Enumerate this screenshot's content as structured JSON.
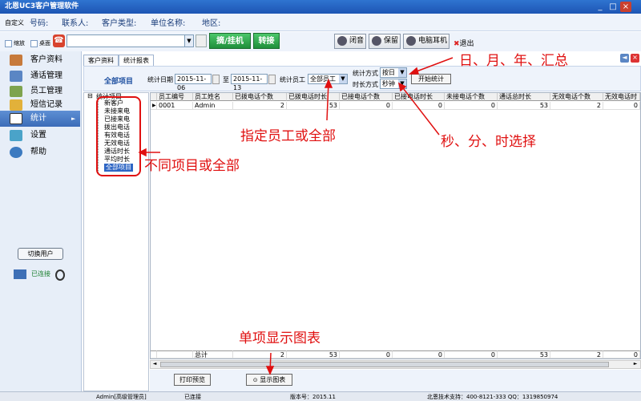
{
  "app_title": "北恩UC3客户管理软件",
  "window_controls": [
    "_",
    "□",
    "×"
  ],
  "infobar": {
    "customize": "自定义",
    "number_label": "号码:",
    "contact_label": "联系人:",
    "customer_type_label": "客户类型:",
    "company_label": "单位名称:",
    "region_label": "地区:"
  },
  "toolbar": {
    "minimize_label": "缩放",
    "desktop_label": "桌面",
    "answer_hangup": "摘/挂机",
    "transfer": "转接",
    "mute": "闭音",
    "hold": "保留",
    "headset": "电脑耳机",
    "exit": "退出"
  },
  "sidebar": {
    "items": [
      {
        "label": "客户资料",
        "icon": "contacts-icon"
      },
      {
        "label": "通话管理",
        "icon": "calls-icon"
      },
      {
        "label": "员工管理",
        "icon": "staff-icon"
      },
      {
        "label": "短信记录",
        "icon": "sms-icon"
      },
      {
        "label": "统计",
        "icon": "stats-icon"
      },
      {
        "label": "设置",
        "icon": "settings-icon"
      },
      {
        "label": "帮助",
        "icon": "help-icon"
      }
    ],
    "switch_user": "切换用户",
    "connected": "已连接"
  },
  "tabs": [
    "客户资料",
    "统计报表"
  ],
  "filter": {
    "scope_title": "全部项目",
    "date_label": "统计日期",
    "date_from": "2015-11-06",
    "to_label": "至",
    "date_to": "2015-11-13",
    "staff_label": "统计员工",
    "staff_value": "全部员工",
    "method_label": "统计方式",
    "method_value": "按日",
    "duration_label": "时长方式",
    "duration_value": "秒钟",
    "start_button": "开始统计"
  },
  "tree": {
    "root": "统计项目",
    "items": [
      "新客户",
      "未接来电",
      "已接来电",
      "拨出电话",
      "有效电话",
      "无效电话",
      "通话时长",
      "平均时长",
      "全部项目"
    ]
  },
  "table": {
    "columns": [
      "员工编号",
      "员工姓名",
      "已拨电话个数",
      "已拨电话时长",
      "已接电话个数",
      "已接电话时长",
      "未接电话个数",
      "通话总时长",
      "无效电话个数",
      "无效电话时"
    ],
    "rows": [
      [
        "0001",
        "Admin",
        "2",
        "53",
        "0",
        "0",
        "0",
        "53",
        "2",
        "0"
      ]
    ],
    "total_row": [
      "",
      "总计",
      "2",
      "53",
      "0",
      "0",
      "0",
      "53",
      "2",
      "0"
    ]
  },
  "bottom": {
    "print_preview": "打印预览",
    "show_chart": "显示图表"
  },
  "status": {
    "user": "Admin[高级管理员]",
    "connection": "已连接",
    "version": "版本号：2015.11",
    "support": "北恩技术支持：400-8121-333 QQ：1319850974"
  },
  "annotations": {
    "period": "日、月、年、汇总",
    "staff": "指定员工或全部",
    "unit": "秒、分、时选择",
    "items": "不同项目或全部",
    "chart": "单项显示图表"
  },
  "accent_color": "#3b6cb8",
  "annotation_color": "#e01010"
}
